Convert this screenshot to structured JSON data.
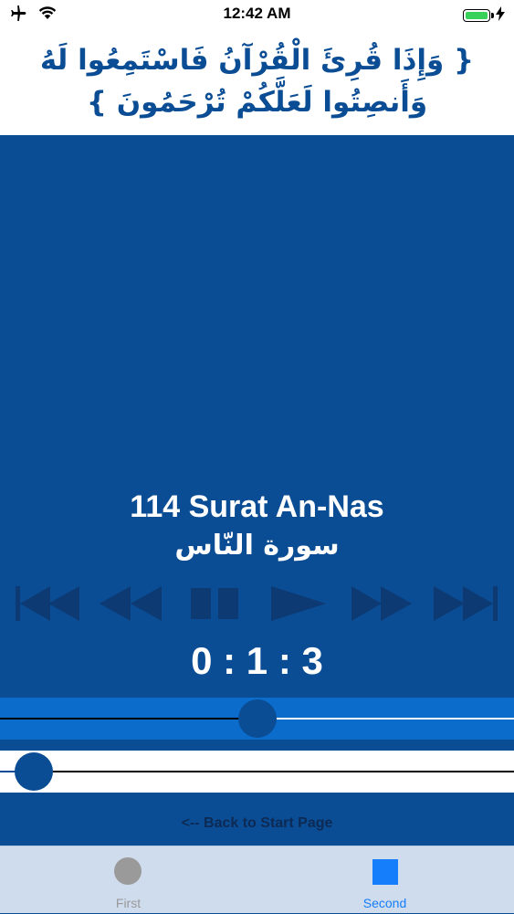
{
  "status_bar": {
    "time": "12:42 AM",
    "icons": [
      "airplane-icon",
      "wifi-icon",
      "battery-icon",
      "charging-bolt-icon"
    ],
    "battery_color": "#36d05a"
  },
  "verse": {
    "text": "{ وَإِذَا قُرِئَ الْقُرْآنُ فَاسْتَمِعُوا لَهُ وَأَنصِتُوا لَعَلَّكُمْ تُرْحَمُونَ }"
  },
  "player": {
    "surah_title": "114 Surat  An-Nas",
    "surah_arabic": "سورة النّاس",
    "time_display": "0 : 1 : 3",
    "controls": [
      {
        "name": "skip-to-start-icon"
      },
      {
        "name": "rewind-icon"
      },
      {
        "name": "pause-icon"
      },
      {
        "name": "play-icon"
      },
      {
        "name": "fast-forward-icon"
      },
      {
        "name": "skip-to-end-icon"
      }
    ],
    "progress_fraction": 0.5,
    "volume_fraction": 0.065
  },
  "back_link": "<-- Back to Start Page",
  "tab_bar": {
    "tabs": [
      {
        "label": "First",
        "icon": "circle-icon",
        "selected": false
      },
      {
        "label": "Second",
        "icon": "square-icon",
        "selected": true
      }
    ]
  },
  "colors": {
    "background": "#0a4d94",
    "slider_band": "#0b6ccb",
    "selected_tab": "#157efb",
    "unselected_tab": "#9a9a9a",
    "control_icons": "#0d3a73"
  }
}
